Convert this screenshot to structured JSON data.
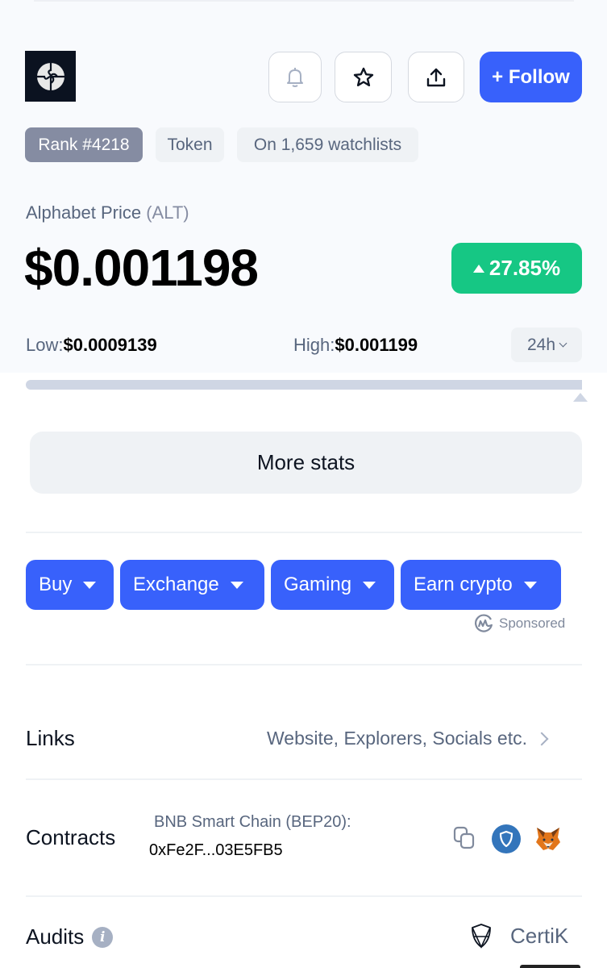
{
  "header": {
    "logo_icon": "puzzle-globe-icon",
    "bell_icon": "bell-icon",
    "star_icon": "star-icon",
    "share_icon": "share-upload-icon",
    "follow_label": "+ Follow"
  },
  "badges": {
    "rank": "Rank #4218",
    "type": "Token",
    "watchlists": "On 1,659 watchlists"
  },
  "price": {
    "label": "Alphabet Price",
    "symbol": "(ALT)",
    "value": "$0.001198",
    "change": "27.85%",
    "change_direction": "up",
    "change_color": "#16c784"
  },
  "range": {
    "low_label": "Low:",
    "low_value": "$0.0009139",
    "high_label": "High:",
    "high_value": "$0.001199",
    "period": "24h",
    "position_fraction": 1.0
  },
  "more_stats_label": "More stats",
  "sponsored": {
    "buttons": [
      {
        "label": "Buy"
      },
      {
        "label": "Exchange"
      },
      {
        "label": "Gaming"
      },
      {
        "label": "Earn crypto"
      }
    ],
    "note": "Sponsored",
    "accent": "#3861fb"
  },
  "links": {
    "label": "Links",
    "value": "Website, Explorers, Socials etc."
  },
  "contracts": {
    "label": "Contracts",
    "chain": "BNB Smart Chain (BEP20):",
    "address": "0xFe2F...03E5FB5"
  },
  "audits": {
    "label": "Audits",
    "auditor": "CertiK"
  }
}
